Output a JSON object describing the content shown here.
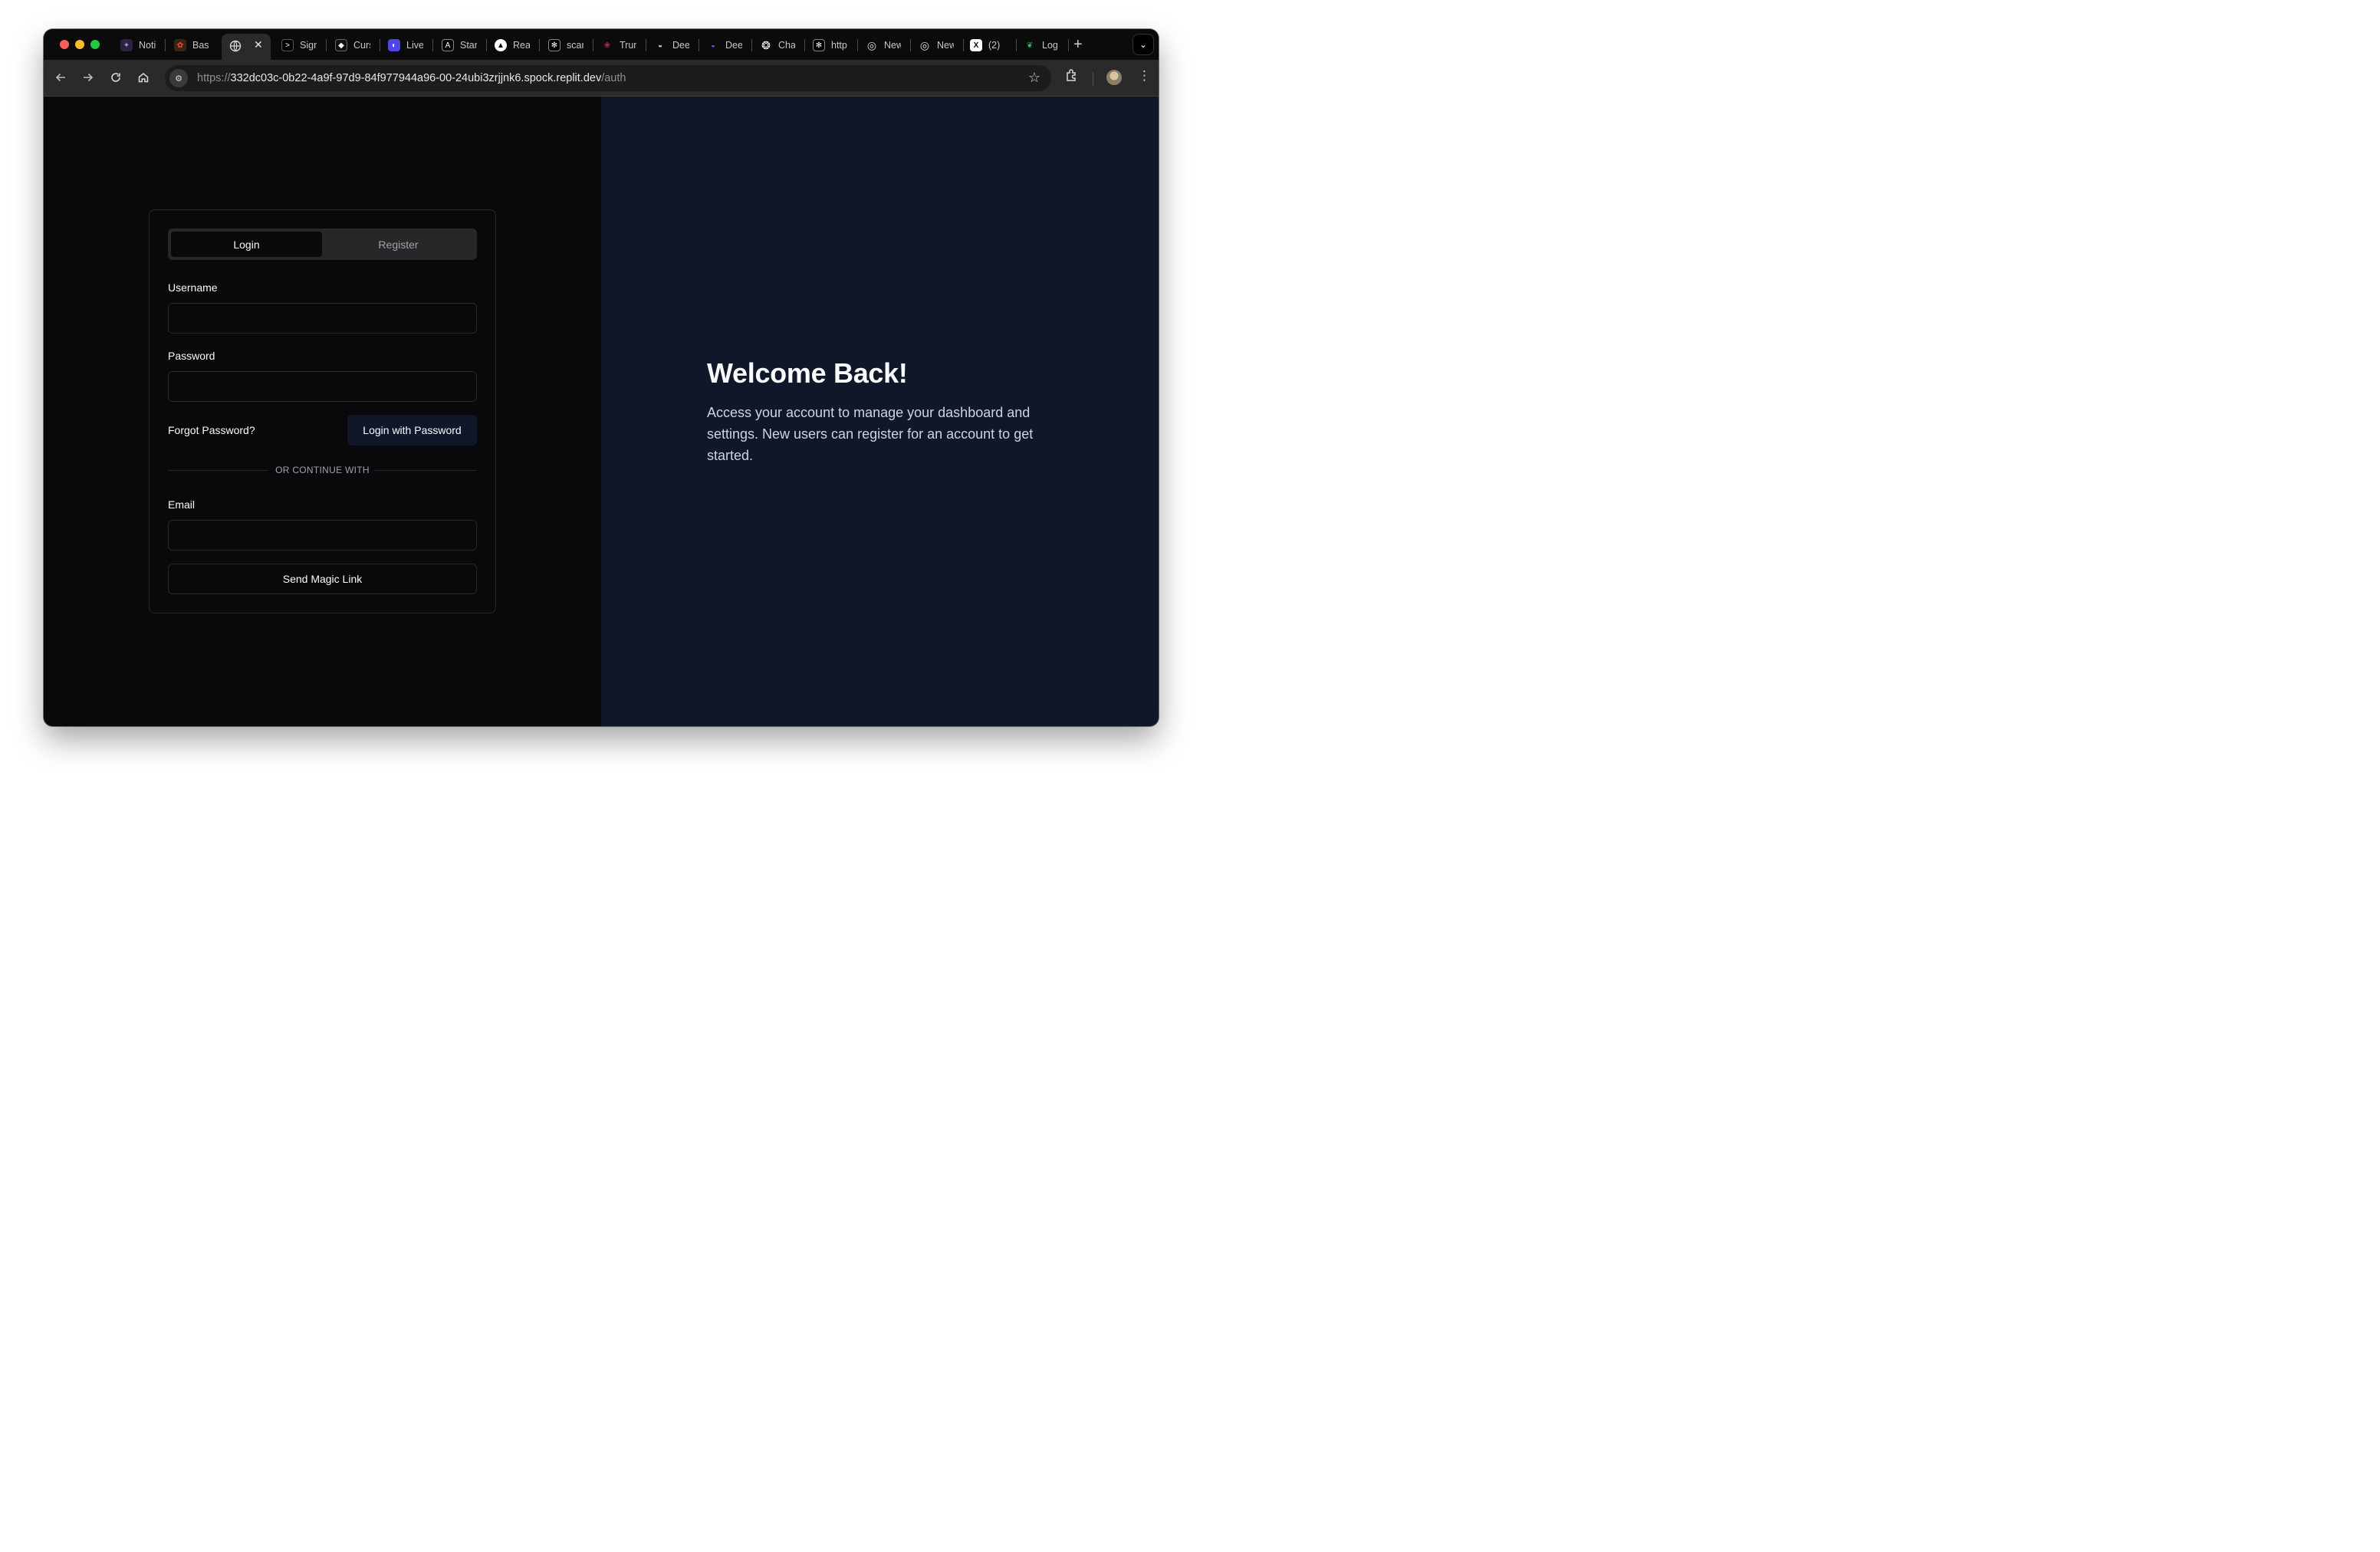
{
  "browser": {
    "tabs": [
      {
        "title": "Notion",
        "favicon": "notion-icon",
        "color": "#6b5bd6"
      },
      {
        "title": "Base",
        "favicon": "figma-icon",
        "color": "#f24e1e"
      },
      {
        "title": "Sign",
        "favicon": "terminal-icon",
        "color": "#ffffff"
      },
      {
        "title": "Cursor",
        "favicon": "cursor-icon",
        "color": "#ffffff"
      },
      {
        "title": "Live",
        "favicon": "live-icon",
        "color": "#4f46e5"
      },
      {
        "title": "Star",
        "favicon": "a-icon",
        "color": "#ffffff"
      },
      {
        "title": "React",
        "favicon": "triangle-icon",
        "color": "#ffffff"
      },
      {
        "title": "scan",
        "favicon": "grid-icon",
        "color": "#ffffff"
      },
      {
        "title": "Trump",
        "favicon": "nbc-icon",
        "color": "#e11d48"
      },
      {
        "title": "Deep",
        "favicon": "whale-icon",
        "color": "#ffffff"
      },
      {
        "title": "Deep",
        "favicon": "whale-blue-icon",
        "color": "#4d6bfe"
      },
      {
        "title": "Chat",
        "favicon": "openai-icon",
        "color": "#ffffff"
      },
      {
        "title": "http",
        "favicon": "grid-icon",
        "color": "#ffffff"
      },
      {
        "title": "New",
        "favicon": "chrome-icon",
        "color": "#ffffff"
      },
      {
        "title": "New",
        "favicon": "chrome-icon",
        "color": "#ffffff"
      },
      {
        "title": "(2)",
        "favicon": "x-icon",
        "color": "#ffffff"
      },
      {
        "title": "Log",
        "favicon": "leaf-icon",
        "color": "#22c55e"
      }
    ],
    "url_prefix": "https://",
    "url_host": "332dc03c-0b22-4a9f-97d9-84f977944a96-00-24ubi3zrjjnk6.spock.replit.dev",
    "url_path": "/auth"
  },
  "auth": {
    "tab_login": "Login",
    "tab_register": "Register",
    "username_label": "Username",
    "username_value": "",
    "password_label": "Password",
    "password_value": "",
    "forgot_password": "Forgot Password?",
    "login_button": "Login with Password",
    "divider": "OR CONTINUE WITH",
    "email_label": "Email",
    "email_value": "",
    "magic_link_button": "Send Magic Link"
  },
  "hero": {
    "title": "Welcome Back!",
    "text": "Access your account to manage your dashboard and settings. New users can register for an account to get started."
  }
}
